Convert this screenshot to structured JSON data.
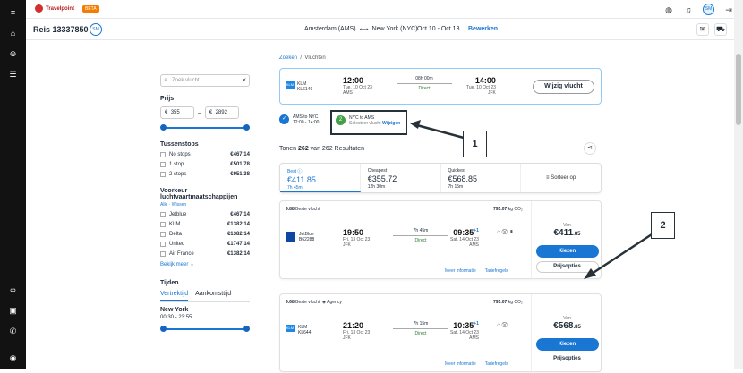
{
  "app": {
    "logo_text": "Travelpoint",
    "beta": "BETA",
    "avatar": "SM"
  },
  "trip": {
    "title": "Reis 13337850",
    "badge": "SM",
    "from": "Amsterdam (AMS)",
    "to": "New York (NYC)",
    "dates": "Oct 10 - Oct 13",
    "edit": "Bewerken"
  },
  "filters": {
    "search_placeholder": "Zoek vlucht",
    "price_title": "Prijs",
    "currency": "€",
    "price_min": "355",
    "price_max": "2892",
    "price_sep": "–",
    "stops_title": "Tussenstops",
    "stops": [
      {
        "label": "No stops",
        "price": "€467.14"
      },
      {
        "label": "1 stop",
        "price": "€501.78"
      },
      {
        "label": "2 stops",
        "price": "€951.38"
      }
    ],
    "airlines_title": "Voorkeur luchtvaartmaatschappijen",
    "alle": "Alle",
    "wissen": "Wissen",
    "airlines": [
      {
        "label": "Jetblue",
        "price": "€467.14"
      },
      {
        "label": "KLM",
        "price": "€1382.14"
      },
      {
        "label": "Delta",
        "price": "€1382.14"
      },
      {
        "label": "United",
        "price": "€1747.14"
      },
      {
        "label": "Air France",
        "price": "€1382.14"
      }
    ],
    "more": "Bekijk meer",
    "times_title": "Tijden",
    "tab_dep": "Vertrektijd",
    "tab_arr": "Aankomsttijd",
    "city": "New York",
    "time_range": "00:30 - 23:55"
  },
  "breadcrumb": {
    "first": "Zoeken",
    "sep": "/",
    "current": "Vluchten"
  },
  "selected": {
    "airline": "KLM",
    "flight": "KL6149",
    "dep_time": "12:00",
    "dep_date": "Tue. 10 Oct 23",
    "dep_code": "AMS",
    "duration": "08h 00m",
    "direct": "Direct",
    "arr_time": "14:00",
    "arr_date": "Tue. 10 Oct 23",
    "arr_code": "JFK",
    "change_btn": "Wijzig vlucht"
  },
  "steps": {
    "s1_num": "✓",
    "s1_title": "AMS to NYC",
    "s1_time": "12:00 - 14:00",
    "s2_num": "2",
    "s2_title": "NYC to AMS",
    "s2_sub": "Selecteer vlucht",
    "s2_link": "Wijzigen"
  },
  "results": {
    "prefix": "Tonen",
    "count": "262",
    "mid": "van 262 Resultaten"
  },
  "sort": [
    {
      "label": "Best",
      "value": "€411.85",
      "sub": "7h 45m"
    },
    {
      "label": "Cheapest",
      "value": "€355.72",
      "sub": "12h 30m"
    },
    {
      "label": "Quickest",
      "value": "€568.85",
      "sub": "7h 15m"
    }
  ],
  "sort_label": "Sorteer op",
  "cards": [
    {
      "score": "9.88",
      "score_label": "Beste vlucht",
      "agency": "",
      "top_price": "795.07",
      "top_suffix": "kg CO₂",
      "airline": "JetBlue",
      "flight": "B62288",
      "dep_time": "19:50",
      "dep_date": "Fri. 13 Oct 23",
      "dep_code": "JFK",
      "duration": "7h 45m",
      "direct": "Direct",
      "arr_time": "09:35",
      "plus": "+1",
      "arr_date": "Sat. 14 Oct 23",
      "arr_code": "AMS",
      "van": "Van",
      "price": "€411",
      "price_cents": ".85",
      "choose": "Kiezen",
      "options": "Prijsopties",
      "more_info": "Meer informatie",
      "tariff": "Tariefregels"
    },
    {
      "score": "9.68",
      "score_label": "Beste vlucht",
      "agency": "Agency",
      "top_price": "795.07",
      "top_suffix": "kg CO₂",
      "airline": "KLM",
      "flight": "KL644",
      "dep_time": "21:20",
      "dep_date": "Fri. 13 Oct 23",
      "dep_code": "JFK",
      "duration": "7h 15m",
      "direct": "Direct",
      "arr_time": "10:35",
      "plus": "+1",
      "arr_date": "Sat. 14 Oct 23",
      "arr_code": "AMS",
      "van": "Van",
      "price": "€568",
      "price_cents": ".85",
      "choose": "Kiezen",
      "options": "Prijsopties",
      "more_info": "Meer informatie",
      "tariff": "Tariefregels"
    }
  ],
  "annotations": {
    "a1": "1",
    "a2": "2"
  },
  "colors": {
    "accent": "#1976d2",
    "rail": "#121212",
    "direct": "#2e7d32"
  }
}
